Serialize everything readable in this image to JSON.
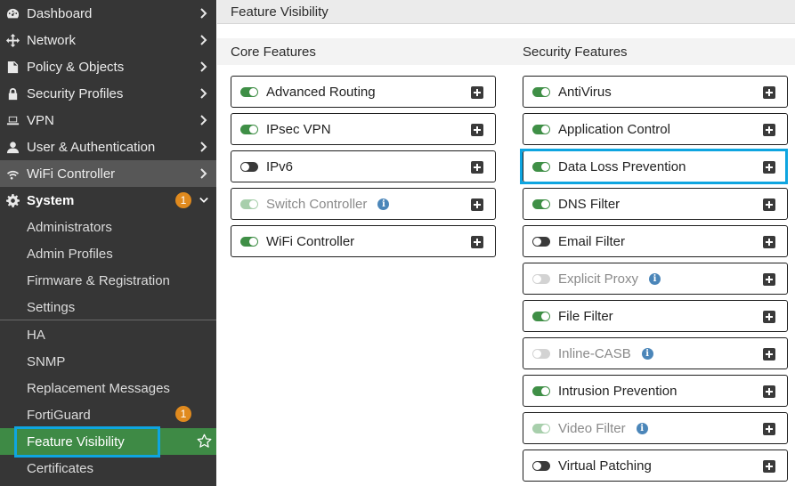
{
  "sidebar": {
    "items": [
      {
        "label": "Dashboard",
        "icon": "dashboard-icon"
      },
      {
        "label": "Network",
        "icon": "network-icon"
      },
      {
        "label": "Policy & Objects",
        "icon": "policy-icon"
      },
      {
        "label": "Security Profiles",
        "icon": "lock-icon"
      },
      {
        "label": "VPN",
        "icon": "laptop-icon"
      },
      {
        "label": "User & Authentication",
        "icon": "user-icon"
      },
      {
        "label": "WiFi Controller",
        "icon": "wifi-icon"
      },
      {
        "label": "System",
        "icon": "gear-icon",
        "badge": "1"
      }
    ],
    "system_sub": [
      {
        "label": "Administrators"
      },
      {
        "label": "Admin Profiles"
      },
      {
        "label": "Firmware & Registration"
      },
      {
        "label": "Settings"
      },
      {
        "label": "HA"
      },
      {
        "label": "SNMP"
      },
      {
        "label": "Replacement Messages"
      },
      {
        "label": "FortiGuard",
        "badge": "1"
      },
      {
        "label": "Feature Visibility"
      },
      {
        "label": "Certificates"
      }
    ],
    "active": "Feature Visibility"
  },
  "main": {
    "title": "Feature Visibility",
    "core_title": "Core Features",
    "security_title": "Security Features",
    "core": [
      {
        "label": "Advanced Routing",
        "state": "on"
      },
      {
        "label": "IPsec VPN",
        "state": "on"
      },
      {
        "label": "IPv6",
        "state": "off"
      },
      {
        "label": "Switch Controller",
        "state": "on-disabled",
        "info": true
      },
      {
        "label": "WiFi Controller",
        "state": "on"
      }
    ],
    "security": [
      {
        "label": "AntiVirus",
        "state": "on"
      },
      {
        "label": "Application Control",
        "state": "on"
      },
      {
        "label": "Data Loss Prevention",
        "state": "on",
        "highlighted": true
      },
      {
        "label": "DNS Filter",
        "state": "on"
      },
      {
        "label": "Email Filter",
        "state": "off"
      },
      {
        "label": "Explicit Proxy",
        "state": "off-disabled",
        "info": true
      },
      {
        "label": "File Filter",
        "state": "on"
      },
      {
        "label": "Inline-CASB",
        "state": "off-disabled",
        "info": true
      },
      {
        "label": "Intrusion Prevention",
        "state": "on"
      },
      {
        "label": "Video Filter",
        "state": "on-disabled",
        "info": true
      },
      {
        "label": "Virtual Patching",
        "state": "off"
      }
    ]
  },
  "colors": {
    "sidebar_bg": "#363636",
    "active_bg": "#3e8a45",
    "toggle_on": "#3f8f46",
    "badge": "#e08a1e",
    "highlight": "#0ea5e0",
    "info": "#4b86b9"
  }
}
